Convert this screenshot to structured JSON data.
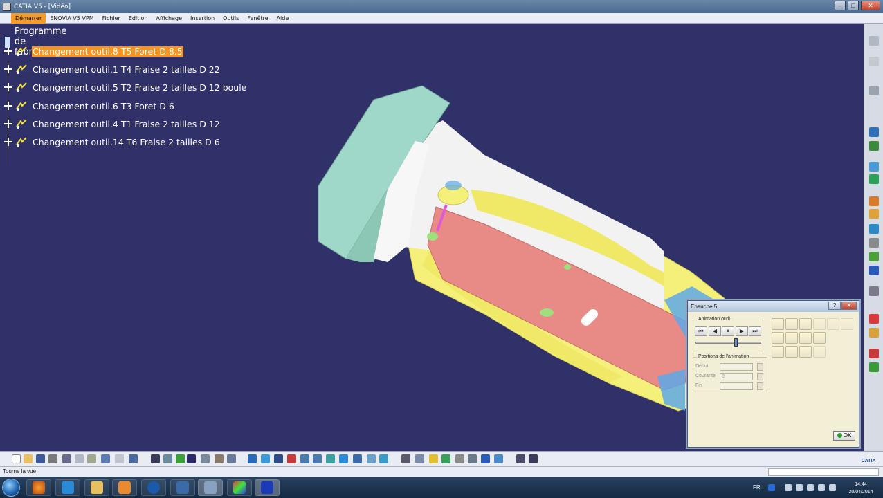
{
  "window": {
    "title": "CATIA V5 - [Vidéo]",
    "minimize": "–",
    "maximize": "□",
    "close": "✕"
  },
  "menu": [
    "Démarrer",
    "ENOVIA V5 VPM",
    "Fichier",
    "Edition",
    "Affichage",
    "Insertion",
    "Outils",
    "Fenêtre",
    "Aide"
  ],
  "tree": {
    "root": "Programme de fabrication.1",
    "items": [
      {
        "label": "Changement outil.8  T5 Foret D 8.5",
        "selected": true
      },
      {
        "label": "Changement outil.1  T4 Fraise 2 tailles D 22",
        "selected": false
      },
      {
        "label": "Changement outil.5  T2 Fraise 2 tailles D 12 boule",
        "selected": false
      },
      {
        "label": "Changement outil.6  T3 Foret D 6",
        "selected": false
      },
      {
        "label": "Changement outil.4  T1 Fraise 2 tailles D 12",
        "selected": false
      },
      {
        "label": "Changement outil.14  T6 Fraise 2 tailles D 6",
        "selected": false
      }
    ]
  },
  "dialog": {
    "title": "Ebauche.5",
    "help": "?",
    "close": "✕",
    "animation_group": "Animation outil",
    "anim_buttons": [
      "⏮",
      "◀",
      "⏸",
      "▶",
      "⏭"
    ],
    "positions_group": "Positions de l'animation",
    "debut_label": "Début",
    "courante_label": "Courante",
    "courante_value": "0",
    "fin_label": "Fin",
    "ok": "OK"
  },
  "status": {
    "text": "Tourne la vue"
  },
  "catia_logo": "CATIA",
  "taskbar": {
    "lang": "FR",
    "time": "14:44",
    "date": "20/04/2014"
  },
  "colors": {
    "viewport_bg": "#31316a",
    "selection": "#f7931e",
    "part_yellow": "#f5f07a",
    "part_white": "#f2f2f2",
    "part_red": "#e88a86",
    "fixture_teal": "#9fd8c8",
    "accent_blue": "#5ea8e8"
  }
}
